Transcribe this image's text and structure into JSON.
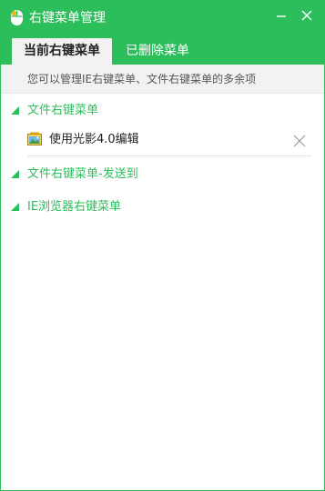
{
  "window": {
    "title": "右键菜单管理",
    "accent_color": "#2dbe5c",
    "icons": {
      "app": "mouse-icon",
      "minimize": "minimize-icon",
      "close": "close-icon"
    }
  },
  "tabs": [
    {
      "label": "当前右键菜单",
      "active": true
    },
    {
      "label": "已删除菜单",
      "active": false
    }
  ],
  "hint": "您可以管理IE右键菜单、文件右键菜单的多余项",
  "sections": [
    {
      "label": "文件右键菜单",
      "expanded": true,
      "items": [
        {
          "label": "使用光影4.0编辑",
          "icon": "photo-editor-icon",
          "action_icon": "remove-x-icon"
        }
      ]
    },
    {
      "label": "文件右键菜单-发送到",
      "expanded": true,
      "items": []
    },
    {
      "label": "IE浏览器右键菜单",
      "expanded": true,
      "items": []
    }
  ]
}
